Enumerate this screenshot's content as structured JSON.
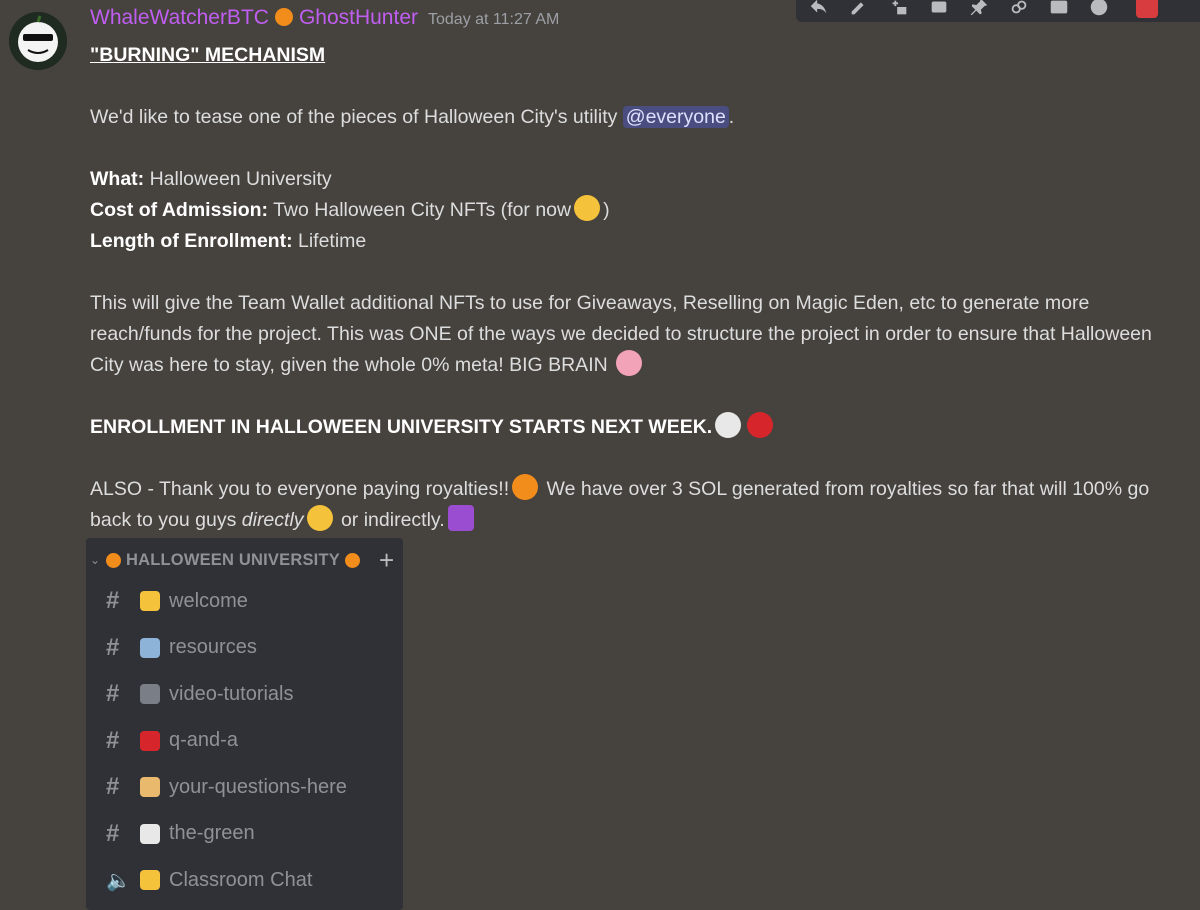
{
  "message": {
    "author": "WhaleWatcherBTC",
    "author_suffix": "GhostHunter",
    "timestamp": "Today at 11:27 AM",
    "title": "\"BURNING\" MECHANISM",
    "intro": "We'd like to tease one of the pieces of Halloween City's utility",
    "mention": "@everyone",
    "intro_end": ".",
    "what_label": "What:",
    "what_value": " Halloween University",
    "cost_label": "Cost of Admission:",
    "cost_value": " Two Halloween City NFTs (for now",
    "cost_end": ")",
    "length_label": "Length of Enrollment:",
    "length_value": " Lifetime",
    "paragraph": "This will give the Team Wallet additional NFTs to use for Giveaways, Reselling on Magic Eden, etc to generate more reach/funds for the project. This was ONE of the ways we decided to structure the project in order to ensure that Halloween City was here to stay, given the whole 0% meta! BIG BRAIN",
    "enroll": "ENROLLMENT IN HALLOWEEN UNIVERSITY STARTS NEXT WEEK.",
    "also_1": "ALSO - Thank you to everyone paying royalties!!",
    "also_2": " We have over 3 SOL generated from royalties so far that will 100% go back to you guys ",
    "also_italic": "directly",
    "also_3": " or indirectly."
  },
  "toolbar": {
    "icons": [
      "reply-icon",
      "edit-icon",
      "add-reaction-icon",
      "thread-icon",
      "pin-icon",
      "link-icon",
      "id-icon",
      "emoji-icon",
      "delete-icon"
    ]
  },
  "channel_panel": {
    "category": "HALLOWEEN UNIVERSITY",
    "channels": [
      {
        "name": "welcome",
        "icon": "star-icon",
        "color": "#f5c33b",
        "type": "text"
      },
      {
        "name": "resources",
        "icon": "folder-icon",
        "color": "#8db4d8",
        "type": "text"
      },
      {
        "name": "video-tutorials",
        "icon": "tv-icon",
        "color": "#7a7f87",
        "type": "text"
      },
      {
        "name": "q-and-a",
        "icon": "apple-icon",
        "color": "#d6262b",
        "type": "text"
      },
      {
        "name": "your-questions-here",
        "icon": "raised-hand-icon",
        "color": "#e9b96e",
        "type": "text"
      },
      {
        "name": "the-green",
        "icon": "speech-bubble-icon",
        "color": "#e8e8e8",
        "type": "text"
      },
      {
        "name": "Classroom Chat",
        "icon": "nerd-face-icon",
        "color": "#f5c33b",
        "type": "voice"
      }
    ]
  }
}
